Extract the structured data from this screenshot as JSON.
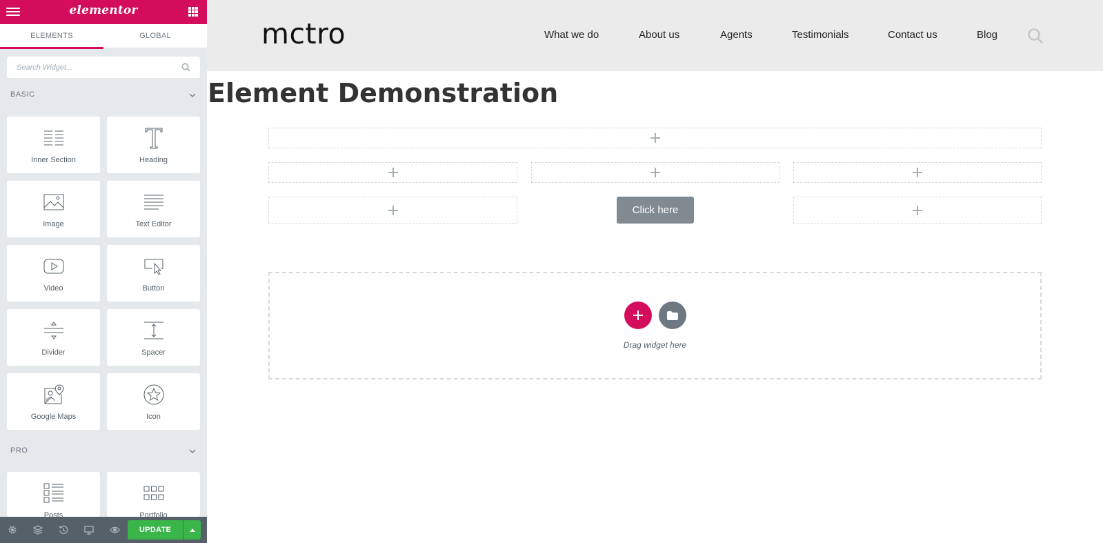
{
  "panel": {
    "logo": "elementor",
    "tabs": [
      {
        "label": "ELEMENTS",
        "active": true
      },
      {
        "label": "GLOBAL",
        "active": false
      }
    ],
    "search": {
      "placeholder": "Search Widget..."
    },
    "categories": [
      {
        "title": "BASIC",
        "widgets": [
          {
            "label": "Inner Section",
            "icon": "inner-section-icon"
          },
          {
            "label": "Heading",
            "icon": "heading-icon"
          },
          {
            "label": "Image",
            "icon": "image-icon"
          },
          {
            "label": "Text Editor",
            "icon": "text-editor-icon"
          },
          {
            "label": "Video",
            "icon": "video-icon"
          },
          {
            "label": "Button",
            "icon": "button-icon"
          },
          {
            "label": "Divider",
            "icon": "divider-icon"
          },
          {
            "label": "Spacer",
            "icon": "spacer-icon"
          },
          {
            "label": "Google Maps",
            "icon": "google-maps-icon"
          },
          {
            "label": "Icon",
            "icon": "star-icon"
          }
        ]
      },
      {
        "title": "PRO",
        "widgets": [
          {
            "label": "Posts",
            "icon": "posts-icon"
          },
          {
            "label": "Portfolio",
            "icon": "portfolio-icon"
          }
        ]
      }
    ],
    "footer": {
      "update_label": "UPDATE",
      "icons": [
        "settings-icon",
        "navigator-icon",
        "history-icon",
        "responsive-icon",
        "preview-icon"
      ]
    },
    "colors": {
      "brand": "#d30c5c",
      "update": "#39b54a",
      "footer": "#556068"
    }
  },
  "site": {
    "logo": "mctro",
    "nav": [
      "What we do",
      "About us",
      "Agents",
      "Testimonials",
      "Contact us",
      "Blog"
    ],
    "page_title": "Element Demonstration",
    "button_label": "Click here",
    "drop_hint": "Drag widget here"
  }
}
